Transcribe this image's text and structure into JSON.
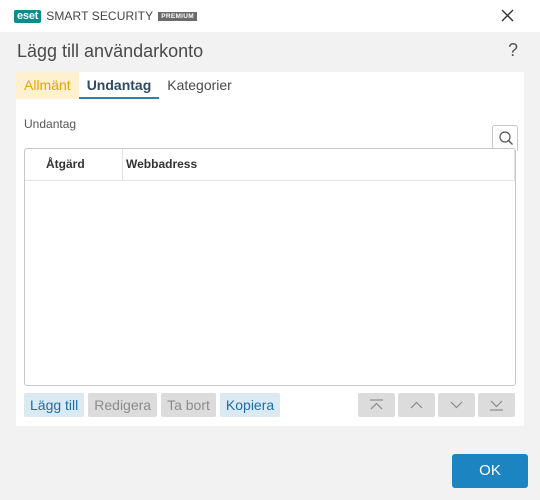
{
  "window": {
    "brand_badge": "eset",
    "product_name": "SMART SECURITY",
    "edition": "PREMIUM",
    "close_icon": "close-icon"
  },
  "dialog": {
    "title": "Lägg till användarkonto",
    "help_label": "?"
  },
  "tabs": [
    {
      "label": "Allmänt",
      "state": "highlighted"
    },
    {
      "label": "Undantag",
      "state": "active"
    },
    {
      "label": "Kategorier",
      "state": "normal"
    }
  ],
  "section": {
    "label": "Undantag",
    "search_icon": "search-icon"
  },
  "table": {
    "columns": [
      "Åtgärd",
      "Webbadress",
      ""
    ],
    "rows": []
  },
  "buttons": {
    "add": "Lägg till",
    "edit": "Redigera",
    "remove": "Ta bort",
    "copy": "Kopiera"
  },
  "ordering": {
    "icons": [
      "move-top-icon",
      "move-up-icon",
      "move-down-icon",
      "move-bottom-icon"
    ]
  },
  "footer": {
    "ok": "OK"
  },
  "colors": {
    "accent": "#1d84c2",
    "brand": "#0a8c8c",
    "highlight_tab_bg": "#fdf1d0",
    "highlight_tab_text": "#e8a400"
  }
}
